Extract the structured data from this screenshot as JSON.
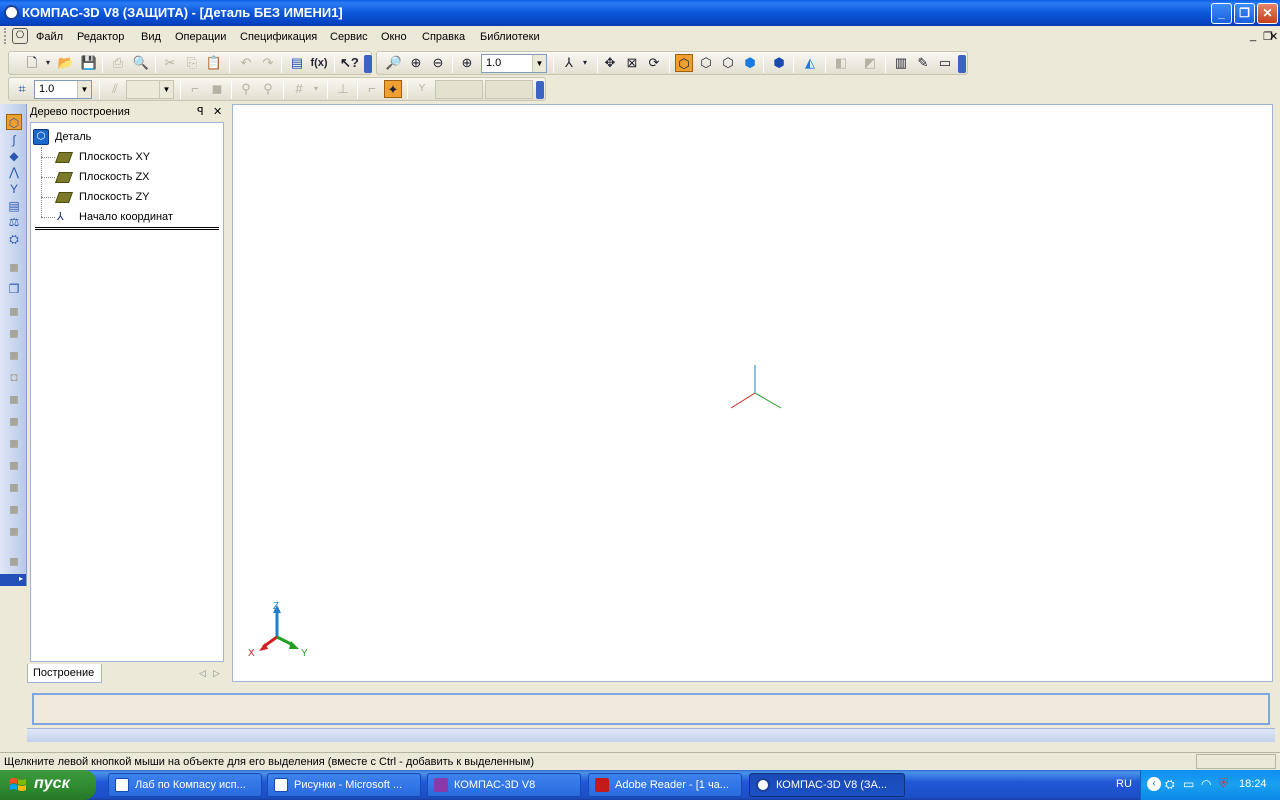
{
  "window": {
    "title": "КОМПАС-3D V8 (ЗАЩИТА) - [Деталь БЕЗ ИМЕНИ1]",
    "minimize_label": "_",
    "restore_label": "❐",
    "close_label": "✕",
    "doc_minimize_label": "_",
    "doc_restore_label": "❐",
    "doc_close_label": "✕"
  },
  "menu": {
    "items": [
      "Файл",
      "Редактор",
      "Вид",
      "Операции",
      "Спецификация",
      "Сервис",
      "Окно",
      "Справка",
      "Библиотеки"
    ]
  },
  "toolbar": {
    "zoom_value": "1.0",
    "step_value": "1.0"
  },
  "tree": {
    "title": "Дерево построения",
    "pin_label": "ꟼ",
    "close_label": "✕",
    "root": "Деталь",
    "items": [
      "Плоскость XY",
      "Плоскость ZX",
      "Плоскость ZY",
      "Начало координат"
    ],
    "tab": "Построение"
  },
  "viewport": {
    "axis_z": "Z",
    "axis_x": "X",
    "axis_y": "Y"
  },
  "statusbar": {
    "text": "Щелкните левой кнопкой мыши на объекте для его выделения (вместе с Ctrl - добавить к выделенным)"
  },
  "taskbar": {
    "start_label": "пуск",
    "tasks": [
      "Лаб по Компасу исп...",
      "Рисунки - Microsoft ...",
      "КОМПАС-3D V8",
      "Adobe Reader - [1 ча...",
      "КОМПАС-3D V8 (ЗА..."
    ],
    "language": "RU",
    "clock": "18:24"
  },
  "colors": {
    "titlebar": "#0b57d8",
    "taskbar": "#2157d7",
    "start": "#2f8a2f",
    "axis_x": "#d02020",
    "axis_y": "#20a020",
    "axis_z": "#2080d0"
  }
}
